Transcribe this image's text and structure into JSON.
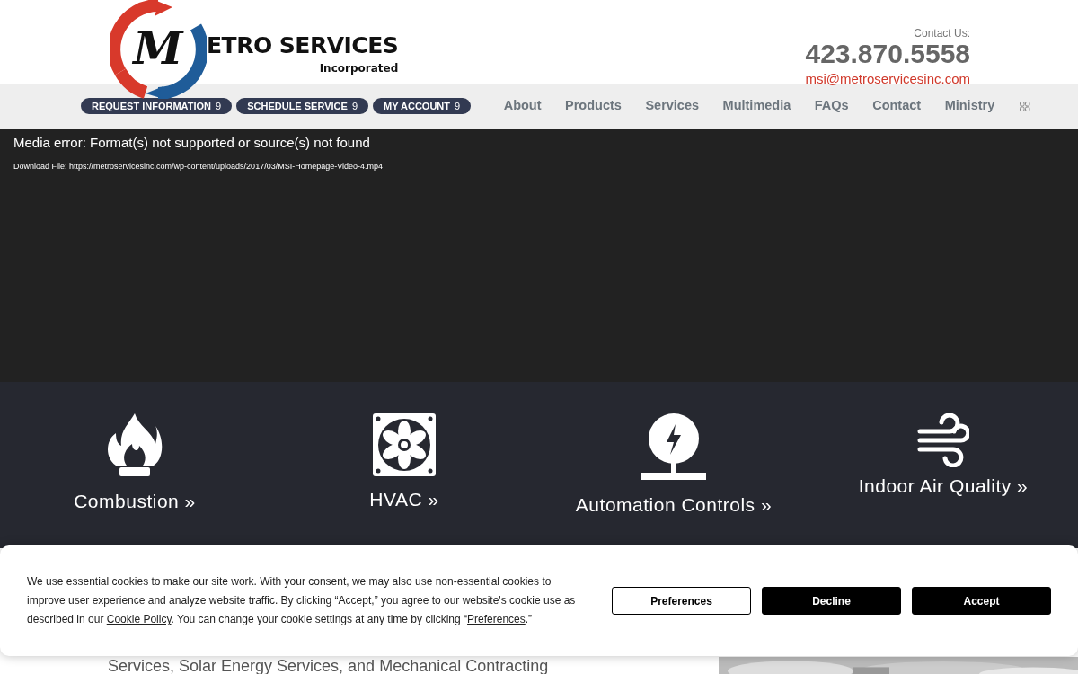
{
  "logo": {
    "letter": "M",
    "name": "ETRO SERVICES",
    "tagline": "Incorporated"
  },
  "contact": {
    "label": "Contact Us:",
    "phone": "423.870.5558",
    "email": "msi@metroservicesinc.com"
  },
  "action_buttons": [
    {
      "label": "REQUEST INFORMATION",
      "marker": "9"
    },
    {
      "label": "SCHEDULE SERVICE",
      "marker": "9"
    },
    {
      "label": "MY ACCOUNT",
      "marker": "9"
    }
  ],
  "nav": [
    "About",
    "Products",
    "Services",
    "Multimedia",
    "FAQs",
    "Contact",
    "Ministry"
  ],
  "media": {
    "error": "Media error: Format(s) not supported or source(s) not found",
    "download": "Download File: https://metroservicesinc.com/wp-content/uploads/2017/03/MSI-Homepage-Video-4.mp4"
  },
  "services": [
    {
      "kind": "flame",
      "label": "Combustion »"
    },
    {
      "kind": "fan",
      "label": "HVAC »"
    },
    {
      "kind": "bolt",
      "label": "Automation Controls »"
    },
    {
      "kind": "wind",
      "label": "Indoor Air Quality »"
    }
  ],
  "page_text": "Services, Solar Energy Services, and Mechanical Contracting",
  "cookie": {
    "text_parts": [
      "We use essential cookies to make our site work. With your consent, we may also use non-essential cookies to improve user experience and analyze website traffic. By clicking “Accept,” you agree to our website's cookie use as described in our ",
      ". You can change your cookie settings at any time by clicking “",
      ".”"
    ],
    "links": [
      "Cookie Policy",
      "Preferences"
    ],
    "buttons": [
      {
        "kind": "outline",
        "label": "Preferences"
      },
      {
        "kind": "solid",
        "label": "Decline"
      },
      {
        "kind": "solid",
        "label": "Accept"
      }
    ]
  }
}
